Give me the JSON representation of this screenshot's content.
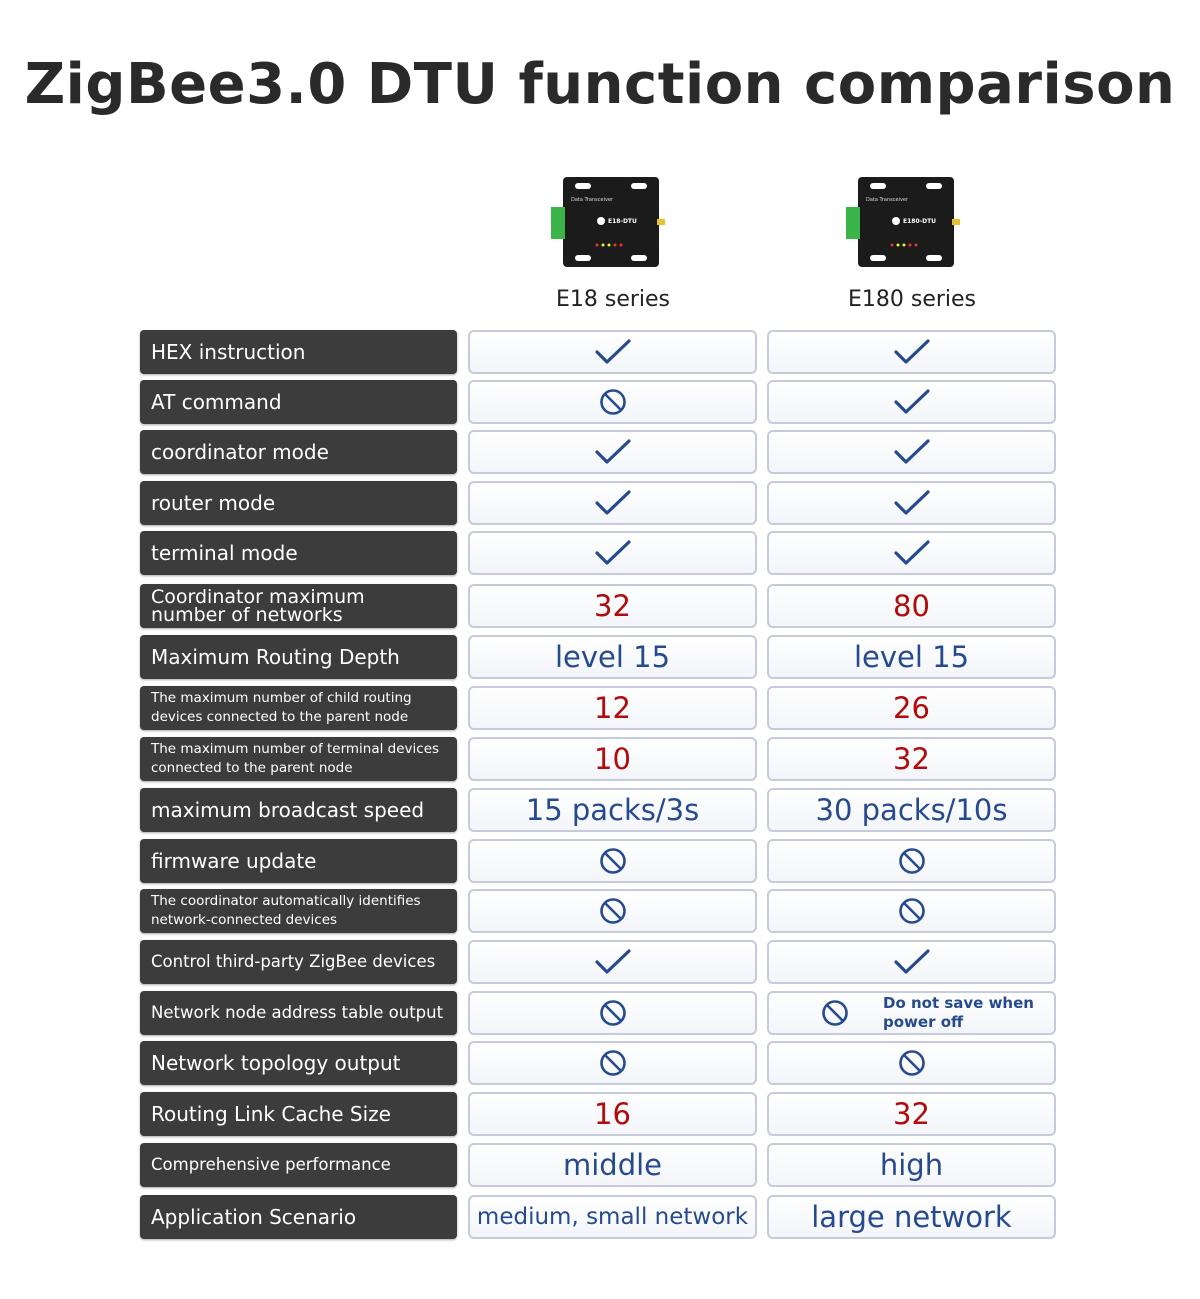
{
  "title": "ZigBee3.0 DTU function comparison",
  "products": [
    {
      "series": "E18 series",
      "image": "e18-dtu-device-photo"
    },
    {
      "series": "E180 series",
      "image": "e180-dtu-device-photo"
    }
  ],
  "colors": {
    "check": "#264a8e",
    "number": "#b10b0b",
    "text": "#264a8e",
    "label_bg": "#3c3c3c"
  },
  "rows": [
    {
      "feature": "HEX instruction",
      "e18": {
        "type": "icon",
        "icon": "check"
      },
      "e180": {
        "type": "icon",
        "icon": "check"
      }
    },
    {
      "feature": "AT command",
      "e18": {
        "type": "icon",
        "icon": "not-supported"
      },
      "e180": {
        "type": "icon",
        "icon": "check"
      }
    },
    {
      "feature": "coordinator mode",
      "e18": {
        "type": "icon",
        "icon": "check"
      },
      "e180": {
        "type": "icon",
        "icon": "check"
      }
    },
    {
      "feature": "router mode",
      "e18": {
        "type": "icon",
        "icon": "check"
      },
      "e180": {
        "type": "icon",
        "icon": "check"
      }
    },
    {
      "feature": "terminal mode",
      "e18": {
        "type": "icon",
        "icon": "check"
      },
      "e180": {
        "type": "icon",
        "icon": "check"
      }
    },
    {
      "feature": "Coordinator maximum number of networks",
      "feature_lines": [
        "Coordinator maximum",
        "number of networks"
      ],
      "e18": {
        "type": "number",
        "value": "32"
      },
      "e180": {
        "type": "number",
        "value": "80"
      }
    },
    {
      "feature": "Maximum Routing Depth",
      "e18": {
        "type": "text",
        "value": "level 15"
      },
      "e180": {
        "type": "text",
        "value": "level 15"
      }
    },
    {
      "feature": "The maximum number of child routing devices connected to the parent node",
      "feature_lines": [
        "The maximum number of child routing",
        "devices connected to the parent node"
      ],
      "e18": {
        "type": "number",
        "value": "12"
      },
      "e180": {
        "type": "number",
        "value": "26"
      }
    },
    {
      "feature": "The maximum number of terminal devices connected to the parent node",
      "feature_lines": [
        "The maximum number of terminal devices",
        "connected to the parent node"
      ],
      "e18": {
        "type": "number",
        "value": "10"
      },
      "e180": {
        "type": "number",
        "value": "32"
      }
    },
    {
      "feature": "maximum broadcast speed",
      "e18": {
        "type": "text",
        "value": "15 packs/3s"
      },
      "e180": {
        "type": "text",
        "value": "30 packs/10s"
      }
    },
    {
      "feature": "firmware update",
      "e18": {
        "type": "icon",
        "icon": "not-supported"
      },
      "e180": {
        "type": "icon",
        "icon": "not-supported"
      }
    },
    {
      "feature": "The coordinator automatically identifies network-connected devices",
      "feature_lines": [
        "The coordinator automatically identifies",
        "network-connected devices"
      ],
      "e18": {
        "type": "icon",
        "icon": "not-supported"
      },
      "e180": {
        "type": "icon",
        "icon": "not-supported"
      }
    },
    {
      "feature": "Control third-party ZigBee devices",
      "e18": {
        "type": "icon",
        "icon": "check"
      },
      "e180": {
        "type": "icon",
        "icon": "check"
      }
    },
    {
      "feature": "Network node address table output",
      "e18": {
        "type": "icon",
        "icon": "not-supported"
      },
      "e180": {
        "type": "icon",
        "icon": "not-supported",
        "note_lines": [
          "Do not save when",
          "power off"
        ]
      }
    },
    {
      "feature": "Network topology output",
      "e18": {
        "type": "icon",
        "icon": "not-supported"
      },
      "e180": {
        "type": "icon",
        "icon": "not-supported"
      }
    },
    {
      "feature": "Routing Link Cache Size",
      "e18": {
        "type": "number",
        "value": "16"
      },
      "e180": {
        "type": "number",
        "value": "32"
      }
    },
    {
      "feature": "Comprehensive performance",
      "e18": {
        "type": "text",
        "value": "middle"
      },
      "e180": {
        "type": "text",
        "value": "high"
      }
    },
    {
      "feature": "Application Scenario",
      "e18": {
        "type": "text",
        "value": "medium, small network"
      },
      "e180": {
        "type": "text",
        "value": "large network"
      }
    }
  ]
}
